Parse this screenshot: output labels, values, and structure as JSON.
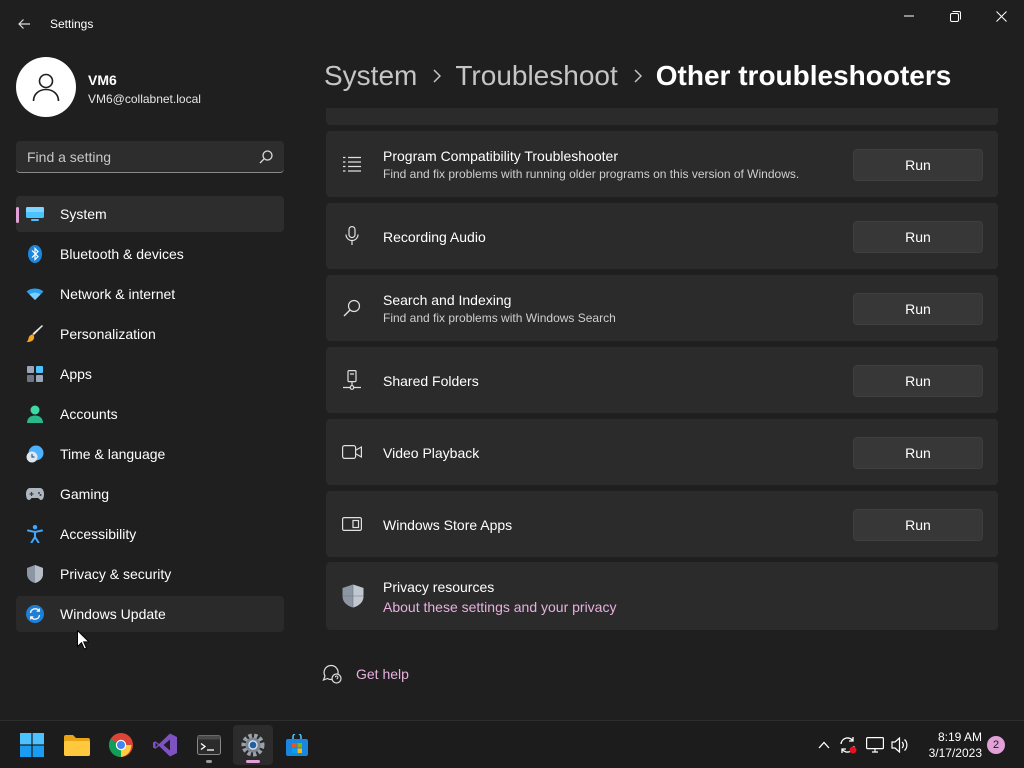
{
  "window": {
    "app_title": "Settings",
    "controls": [
      "minimize",
      "maximize",
      "close"
    ]
  },
  "profile": {
    "name": "VM6",
    "email": "VM6@collabnet.local"
  },
  "search": {
    "placeholder": "Find a setting"
  },
  "sidebar": {
    "items": [
      {
        "label": "System",
        "icon": "monitor-icon",
        "selected": true
      },
      {
        "label": "Bluetooth & devices",
        "icon": "bluetooth-icon"
      },
      {
        "label": "Network & internet",
        "icon": "wifi-icon"
      },
      {
        "label": "Personalization",
        "icon": "brush-icon"
      },
      {
        "label": "Apps",
        "icon": "apps-icon"
      },
      {
        "label": "Accounts",
        "icon": "person-icon"
      },
      {
        "label": "Time & language",
        "icon": "clock-globe-icon"
      },
      {
        "label": "Gaming",
        "icon": "gamepad-icon"
      },
      {
        "label": "Accessibility",
        "icon": "accessibility-icon"
      },
      {
        "label": "Privacy & security",
        "icon": "shield-icon"
      },
      {
        "label": "Windows Update",
        "icon": "update-icon",
        "hover": true
      }
    ]
  },
  "breadcrumb": {
    "items": [
      "System",
      "Troubleshoot",
      "Other troubleshooters"
    ]
  },
  "troubleshooters": [
    {
      "title": "Program Compatibility Troubleshooter",
      "desc": "Find and fix problems with running older programs on this version of Windows.",
      "icon": "list-icon",
      "button": "Run"
    },
    {
      "title": "Recording Audio",
      "desc": "",
      "icon": "microphone-icon",
      "button": "Run"
    },
    {
      "title": "Search and Indexing",
      "desc": "Find and fix problems with Windows Search",
      "icon": "search-icon",
      "button": "Run"
    },
    {
      "title": "Shared Folders",
      "desc": "",
      "icon": "network-drive-icon",
      "button": "Run"
    },
    {
      "title": "Video Playback",
      "desc": "",
      "icon": "video-icon",
      "button": "Run"
    },
    {
      "title": "Windows Store Apps",
      "desc": "",
      "icon": "store-app-icon",
      "button": "Run"
    }
  ],
  "privacy": {
    "title": "Privacy resources",
    "link": "About these settings and your privacy"
  },
  "help": {
    "label": "Get help"
  },
  "taskbar": {
    "apps": [
      "start-icon",
      "file-explorer-icon",
      "chrome-icon",
      "visual-studio-icon",
      "terminal-icon",
      "settings-icon",
      "store-icon"
    ],
    "tray": [
      "chevron-up-icon",
      "sync-icon",
      "network-icon",
      "volume-icon"
    ],
    "time": "8:19 AM",
    "date": "3/17/2023",
    "notifications": "2"
  },
  "colors": {
    "accent": "#e2a0d8",
    "card": "#2b2b2b",
    "background": "#1f1f1f"
  }
}
